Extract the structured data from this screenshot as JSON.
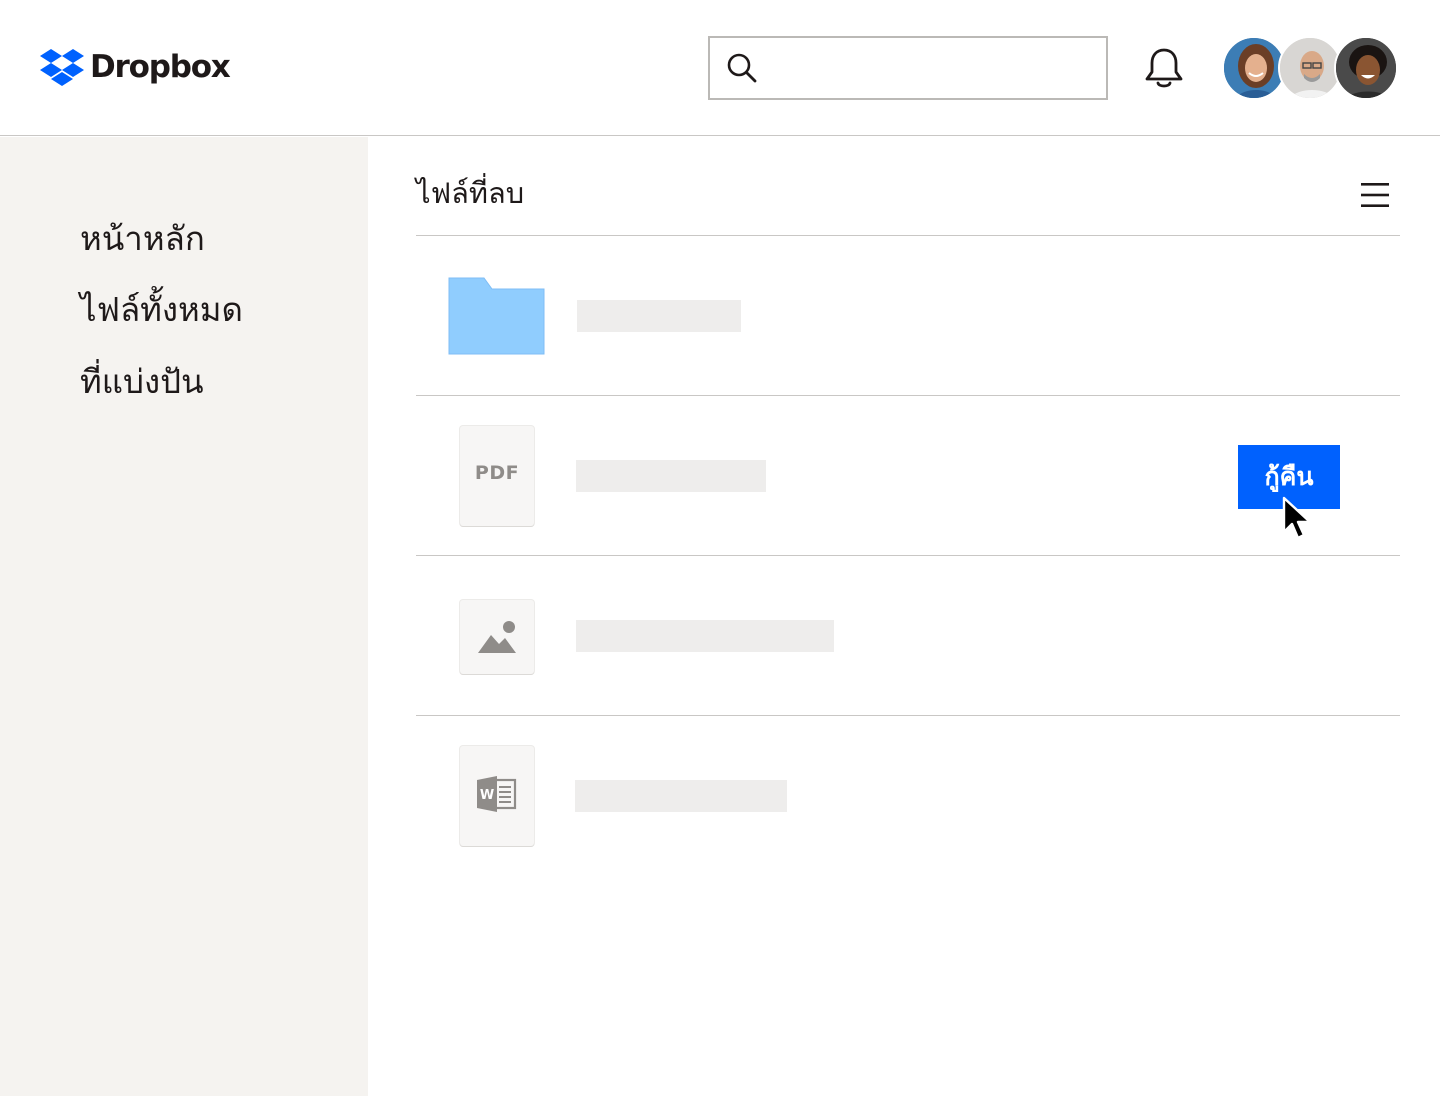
{
  "header": {
    "brand": "Dropbox",
    "search": {
      "placeholder": "",
      "value": ""
    },
    "icons": {
      "search": "search-icon",
      "notifications": "bell-icon"
    },
    "avatars": [
      "avatar-woman-curly-hair",
      "avatar-man-glasses",
      "avatar-woman-smiling"
    ]
  },
  "sidebar": {
    "items": [
      {
        "label": "หน้าหลัก"
      },
      {
        "label": "ไฟล์ทั้งหมด"
      },
      {
        "label": "ที่แบ่งปัน"
      }
    ]
  },
  "main": {
    "title": "ไฟล์ที่ลบ",
    "menu_icon": "hamburger-menu-icon",
    "files": [
      {
        "type": "folder",
        "icon": "folder-icon",
        "label": ""
      },
      {
        "type": "pdf",
        "icon": "pdf-file-icon",
        "label": "PDF",
        "action": "กู้คืน"
      },
      {
        "type": "image",
        "icon": "image-file-icon",
        "label": ""
      },
      {
        "type": "word",
        "icon": "word-file-icon",
        "label": ""
      }
    ]
  },
  "colors": {
    "accent": "#0061fe",
    "sidebar_bg": "#f5f3f0",
    "folder": "#90cdfe",
    "placeholder_bar": "#eeedec"
  }
}
